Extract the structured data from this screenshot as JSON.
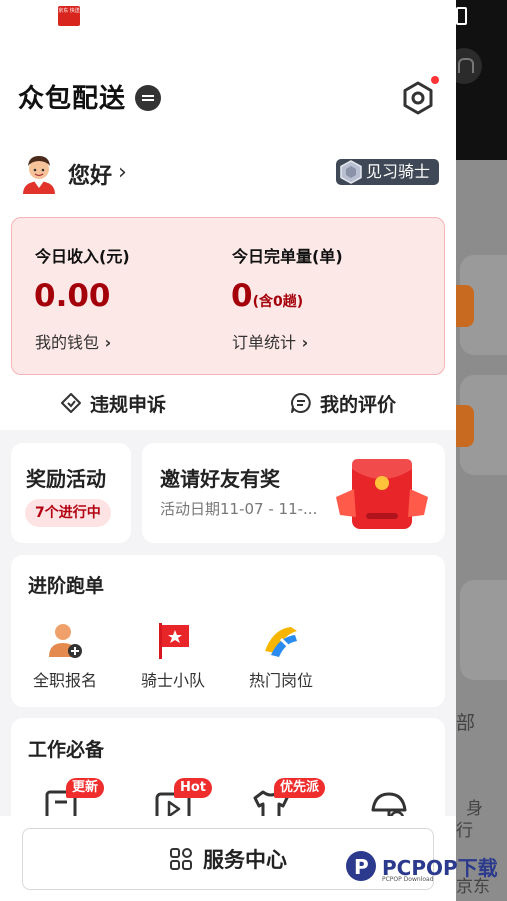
{
  "drawer": {
    "title": "众包配送",
    "greeting": "您好",
    "level_badge": "见习骑士",
    "income": {
      "today_income_label": "今日收入(元)",
      "today_income_value": "0.00",
      "today_orders_label": "今日完单量(单)",
      "today_orders_value": "0",
      "today_orders_sub": "(含0趟)",
      "wallet_link": "我的钱包",
      "stats_link": "订单统计"
    },
    "actions": {
      "appeal": "违规申诉",
      "review": "我的评价"
    },
    "reward": {
      "title": "奖励活动",
      "badge": "7个进行中"
    },
    "invite": {
      "title": "邀请好友有奖",
      "subtitle": "活动日期11-07 - 11-..."
    },
    "advance": {
      "title": "进阶跑单",
      "items": [
        {
          "label": "全职报名",
          "icon": "fulltime-signup-icon"
        },
        {
          "label": "骑士小队",
          "icon": "rider-team-flag-icon"
        },
        {
          "label": "热门岗位",
          "icon": "hot-position-icon"
        }
      ]
    },
    "work": {
      "title": "工作必备",
      "tags": [
        "更新",
        "Hot",
        "优先派"
      ]
    },
    "service_center": "服务中心"
  },
  "background": {
    "text_1": "部",
    "text_2": "身",
    "text_3": "行",
    "text_4": "京东"
  },
  "watermark": {
    "brand": "PCPOP下载",
    "small": "PCPOP Download"
  },
  "app_badge": "京东 快送",
  "colors": {
    "accent": "#a4000a",
    "card_pink": "#fde8e8",
    "tag_red": "#ef2d2d"
  }
}
